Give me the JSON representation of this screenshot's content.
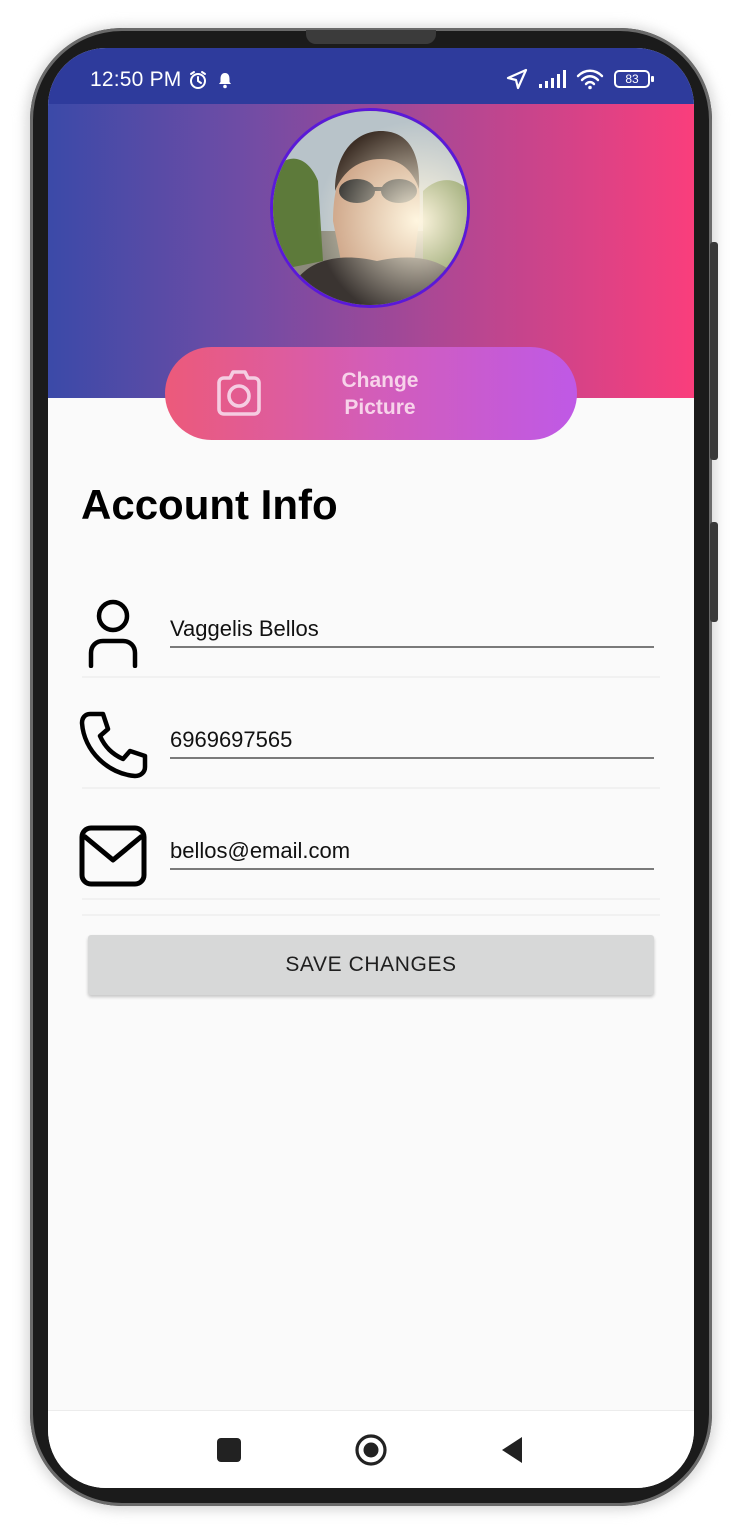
{
  "status_bar": {
    "time": "12:50 PM",
    "left_icons": [
      "alarm-icon",
      "notification-bell-icon"
    ],
    "right_icons": [
      "location-arrow-icon",
      "signal-icon",
      "wifi-icon"
    ],
    "battery_level": "83"
  },
  "header": {
    "gradient_colors": [
      "#3b4aa8",
      "#b04793",
      "#fa3e7c"
    ],
    "avatar_description_icon": "profile-photo",
    "change_picture_label": "Change\nPicture",
    "change_picture_icon": "camera-icon"
  },
  "account": {
    "title": "Account Info",
    "fields": [
      {
        "icon": "person-icon",
        "value": "Vaggelis Bellos"
      },
      {
        "icon": "phone-icon",
        "value": "6969697565"
      },
      {
        "icon": "mail-icon",
        "value": "bellos@email.com"
      }
    ],
    "save_label": "SAVE CHANGES"
  },
  "nav": {
    "buttons": [
      "recent-apps-icon",
      "home-icon",
      "back-icon"
    ]
  }
}
